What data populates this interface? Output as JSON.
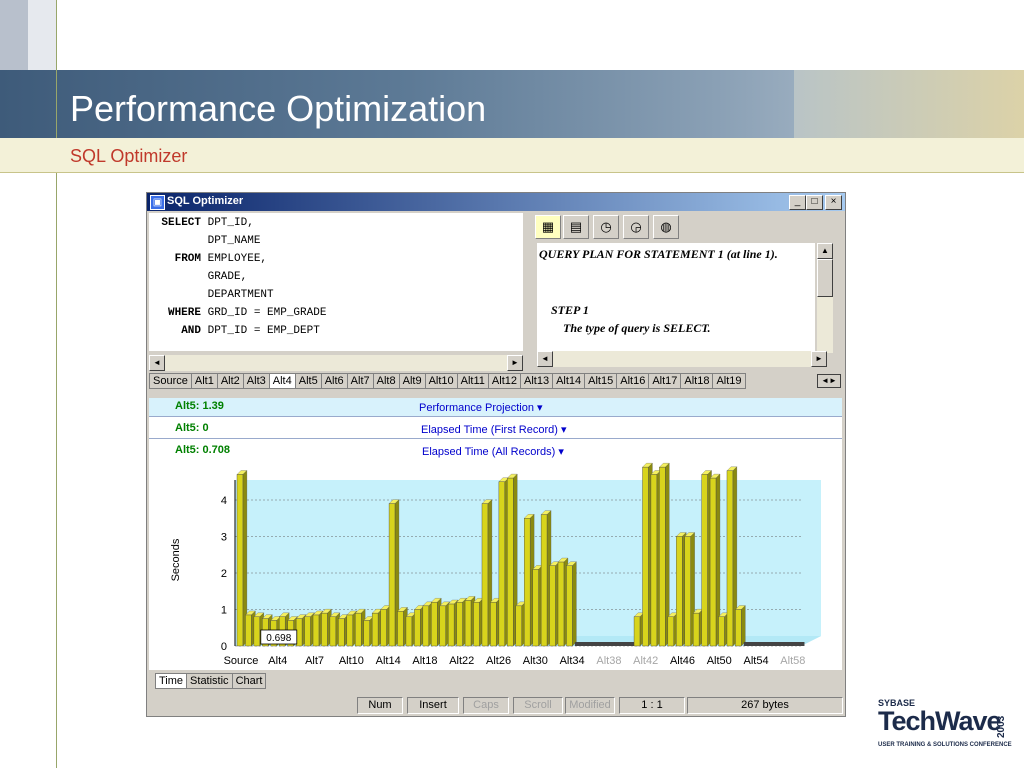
{
  "slide": {
    "title": "Performance Optimization",
    "subtitle": "SQL Optimizer"
  },
  "window": {
    "title": "SQL Optimizer",
    "controls": [
      "_",
      "□",
      "×"
    ]
  },
  "editor": {
    "lines": [
      {
        "kw": "SELECT",
        "rest": "DPT_ID,"
      },
      {
        "kw": "",
        "rest": "DPT_NAME"
      },
      {
        "kw": "FROM",
        "rest": "EMPLOYEE,"
      },
      {
        "kw": "",
        "rest": "GRADE,"
      },
      {
        "kw": "",
        "rest": "DEPARTMENT"
      },
      {
        "kw": "WHERE",
        "rest": "GRD_ID = EMP_GRADE"
      },
      {
        "kw": "AND",
        "rest": "DPT_ID = EMP_DEPT"
      }
    ]
  },
  "plan": {
    "heading": "QUERY PLAN FOR STATEMENT 1 (at line 1).",
    "step": "STEP 1",
    "detail": "The type of query is SELECT."
  },
  "tabs": [
    "Source",
    "Alt1",
    "Alt2",
    "Alt3",
    "Alt4",
    "Alt5",
    "Alt6",
    "Alt7",
    "Alt8",
    "Alt9",
    "Alt10",
    "Alt11",
    "Alt12",
    "Alt13",
    "Alt14",
    "Alt15",
    "Alt16",
    "Alt17",
    "Alt18",
    "Alt19"
  ],
  "selected_tab": "Alt4",
  "headers": [
    {
      "value": "Alt5: 1.39",
      "label": "Performance Projection ▾"
    },
    {
      "value": "Alt5: 0",
      "label": "Elapsed Time (First Record) ▾"
    },
    {
      "value": "Alt5: 0.708",
      "label": "Elapsed Time (All Records) ▾"
    }
  ],
  "chart_data": {
    "type": "bar",
    "ylabel": "Seconds",
    "ylim": [
      0,
      4.8
    ],
    "yticks": [
      0,
      1,
      2,
      3,
      4
    ],
    "xtick_labels": [
      "Source",
      "Alt4",
      "Alt7",
      "Alt10",
      "Alt14",
      "Alt18",
      "Alt22",
      "Alt26",
      "Alt30",
      "Alt34",
      "Alt38",
      "Alt42",
      "Alt46",
      "Alt50",
      "Alt54",
      "Alt58"
    ],
    "xtick_dim": [
      "Alt38",
      "Alt42",
      "Alt58"
    ],
    "values": [
      4.7,
      0.85,
      0.8,
      0.75,
      0.7,
      0.8,
      0.7,
      0.75,
      0.8,
      0.85,
      0.9,
      0.8,
      0.75,
      0.85,
      0.9,
      0.7,
      0.9,
      1.0,
      3.9,
      0.95,
      0.8,
      1.0,
      1.1,
      1.2,
      1.1,
      1.15,
      1.2,
      1.25,
      1.2,
      3.9,
      1.2,
      4.5,
      4.6,
      1.1,
      3.5,
      2.1,
      3.6,
      2.2,
      2.3,
      2.2,
      0,
      0,
      0,
      0,
      0,
      0,
      0,
      0.8,
      4.9,
      4.7,
      4.9,
      0.8,
      3.0,
      3.0,
      0.9,
      4.7,
      4.6,
      0.8,
      4.8,
      1.0,
      0,
      0,
      0,
      0,
      0,
      0,
      0
    ],
    "annotation": "0.698"
  },
  "bottom_tabs": [
    "Time",
    "Statistic",
    "Chart"
  ],
  "status": {
    "num": "Num",
    "insert": "Insert",
    "caps": "Caps",
    "scroll": "Scroll",
    "modified": "Modified",
    "position": "1 : 1",
    "size": "267 bytes"
  },
  "logo": {
    "brand": "SYBASE",
    "name": "TechWave",
    "year": "2003",
    "tagline": "USER TRAINING & SOLUTIONS CONFERENCE"
  }
}
